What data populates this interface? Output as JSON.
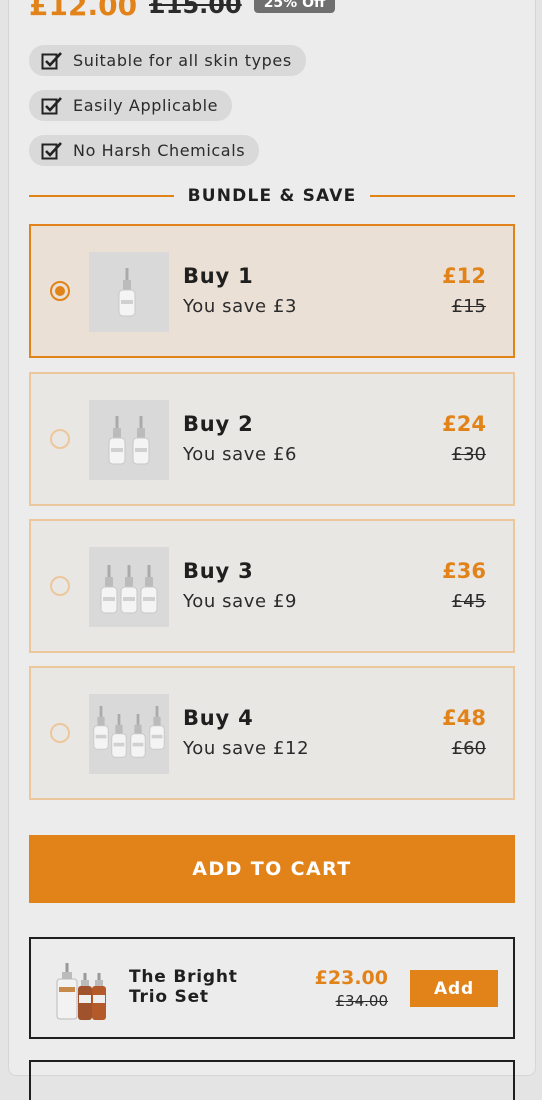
{
  "header": {
    "price": "£12.00",
    "old_price": "£15.00",
    "discount": "25% Off"
  },
  "features": [
    {
      "label": "Suitable for all skin types",
      "icon": "checkbox-checked-icon"
    },
    {
      "label": "Easily Applicable",
      "icon": "checkbox-checked-icon"
    },
    {
      "label": "No Harsh Chemicals",
      "icon": "checkbox-checked-icon"
    }
  ],
  "bundle": {
    "title": "BUNDLE & SAVE",
    "options": [
      {
        "title": "Buy 1",
        "saving": "You save £3",
        "price": "£12",
        "old_price": "£15",
        "selected": true,
        "bottles": 1
      },
      {
        "title": "Buy 2",
        "saving": "You save £6",
        "price": "£24",
        "old_price": "£30",
        "selected": false,
        "bottles": 2
      },
      {
        "title": "Buy 3",
        "saving": "You save £9",
        "price": "£36",
        "old_price": "£45",
        "selected": false,
        "bottles": 3
      },
      {
        "title": "Buy 4",
        "saving": "You save £12",
        "price": "£48",
        "old_price": "£60",
        "selected": false,
        "bottles": 4
      }
    ]
  },
  "cart_button": "ADD TO CART",
  "upsell": {
    "name": "The Bright Trio Set",
    "price": "£23.00",
    "old_price": "£34.00",
    "button": "Add"
  },
  "colors": {
    "accent": "#e2831a",
    "accent_light": "#edc79c",
    "selected_bg": "#ebe0d5"
  }
}
